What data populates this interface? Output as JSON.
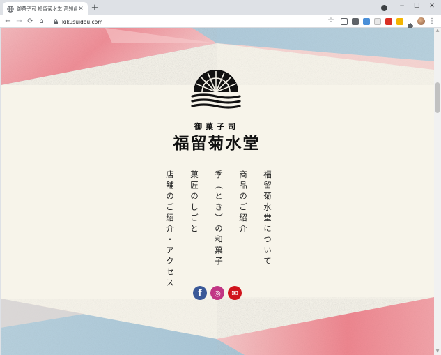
{
  "browser": {
    "tab_title": "御菓子司 福留菊水堂 高知県高知",
    "new_tab_glyph": "+",
    "url": "kikusuidou.com",
    "icons": [
      "globe-icon",
      "close-icon",
      "plus-icon",
      "record-icon",
      "minimize-icon",
      "maximize-icon",
      "close-window-icon",
      "back-icon",
      "forward-icon",
      "reload-icon",
      "home-icon",
      "lock-icon",
      "star-icon",
      "puzzle-icon",
      "menu-icon"
    ],
    "window_controls": {
      "minimize": "−",
      "maximize": "☐",
      "close": "✕"
    },
    "nav_glyphs": {
      "back": "←",
      "forward": "→",
      "reload": "⟳",
      "home": "⌂",
      "star": "☆",
      "menu": "⋮"
    }
  },
  "page": {
    "brand_small": "御菓子司",
    "brand_name": "福留菊水堂",
    "nav": [
      "福留菊水堂について",
      "商品のご紹介",
      "季（とき）の和菓子",
      "菓匠のしごと",
      "店舗のご紹介・アクセス"
    ],
    "social": [
      {
        "name": "facebook-icon",
        "glyph": "f",
        "color": "#3b5998"
      },
      {
        "name": "instagram-icon",
        "glyph": "◎",
        "color": "#c13584"
      },
      {
        "name": "mail-icon",
        "glyph": "✉",
        "color": "#d0141c"
      }
    ],
    "colors": {
      "paper": "#f7f4ea",
      "pink": "#f2a7ae",
      "blue": "#a9c7d8",
      "ink": "#111111"
    }
  }
}
